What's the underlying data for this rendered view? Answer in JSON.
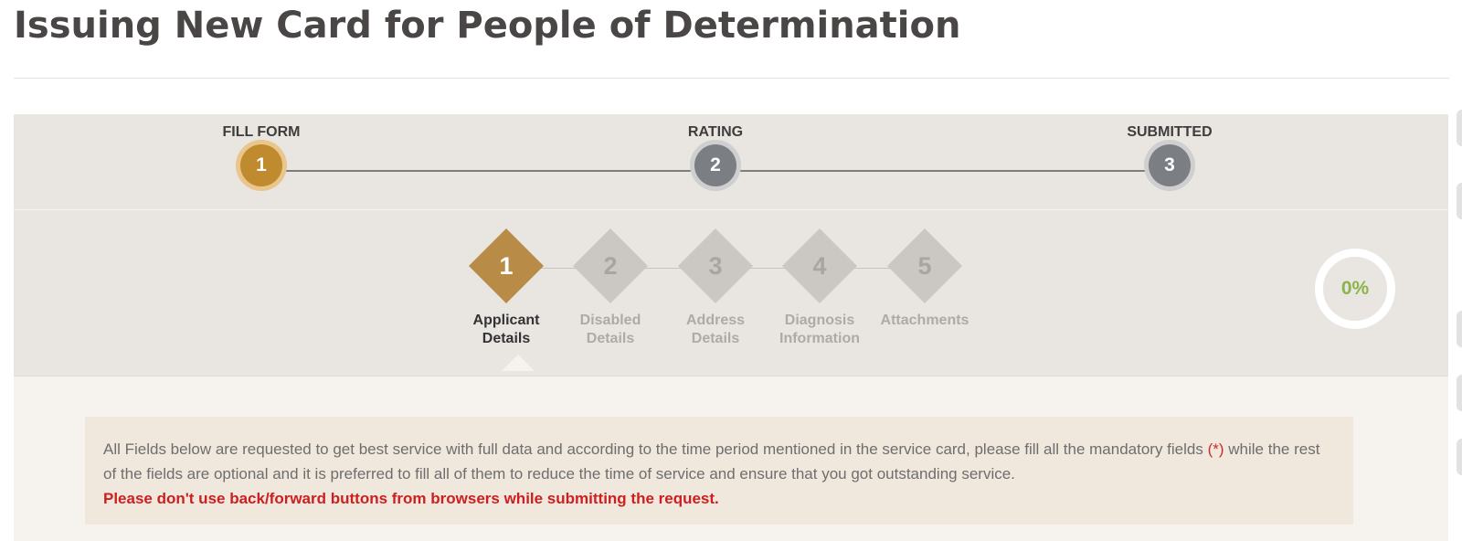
{
  "page": {
    "title": "Issuing New Card for People of Determination"
  },
  "main_steps": [
    {
      "label": "FILL FORM",
      "number": "1",
      "state": "active"
    },
    {
      "label": "RATING",
      "number": "2",
      "state": "idle"
    },
    {
      "label": "SUBMITTED",
      "number": "3",
      "state": "idle"
    }
  ],
  "sub_steps": [
    {
      "number": "1",
      "label_line1": "Applicant",
      "label_line2": "Details",
      "state": "active"
    },
    {
      "number": "2",
      "label_line1": "Disabled",
      "label_line2": "Details",
      "state": "idle"
    },
    {
      "number": "3",
      "label_line1": "Address",
      "label_line2": "Details",
      "state": "idle"
    },
    {
      "number": "4",
      "label_line1": "Diagnosis",
      "label_line2": "Information",
      "state": "idle"
    },
    {
      "number": "5",
      "label_line1": "Attachments",
      "label_line2": "",
      "state": "idle"
    }
  ],
  "progress": {
    "value": 0,
    "text": "0%"
  },
  "notice": {
    "text_before_asterisk": "All Fields below are requested to get best service with full data and according to the time period mentioned in the service card, please fill all the mandatory fields ",
    "asterisk": "(*)",
    "text_after_asterisk": " while the rest of the fields are optional and it is preferred to fill all of them to reduce the time of service and ensure that you got outstanding service.",
    "warning": "Please don't use back/forward buttons from browsers while submitting the request."
  },
  "colors": {
    "active_step": "#c08a2e",
    "idle_step": "#7b7e82",
    "active_diamond": "#b88c47",
    "idle_diamond": "#cbc7c2",
    "progress_text": "#8cb34a",
    "warning": "#cc1f1f"
  }
}
